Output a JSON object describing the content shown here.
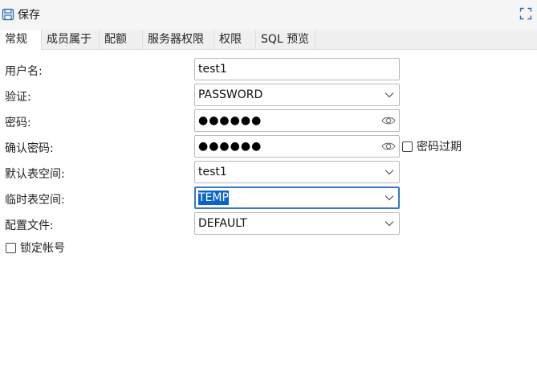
{
  "toolbar": {
    "save_label": "保存",
    "save_icon": "floppy-disk-icon",
    "expand_icon": "fullscreen-expand-icon"
  },
  "tabs": [
    {
      "label": "常规",
      "active": true
    },
    {
      "label": "成员属于",
      "active": false
    },
    {
      "label": "配额",
      "active": false
    },
    {
      "label": "服务器权限",
      "active": false
    },
    {
      "label": "权限",
      "active": false
    },
    {
      "label": "SQL 预览",
      "active": false
    }
  ],
  "form": {
    "username": {
      "label": "用户名:",
      "value": "test1"
    },
    "auth": {
      "label": "验证:",
      "value": "PASSWORD"
    },
    "password": {
      "label": "密码:",
      "masked": "●●●●●●"
    },
    "confirm_password": {
      "label": "确认密码:",
      "masked": "●●●●●●"
    },
    "password_expired": {
      "label": "密码过期",
      "checked": false
    },
    "default_tablespace": {
      "label": "默认表空间:",
      "value": "test1"
    },
    "temp_tablespace": {
      "label": "临时表空间:",
      "value": "TEMP"
    },
    "profile": {
      "label": "配置文件:",
      "value": "DEFAULT"
    },
    "lock_account": {
      "label": "锁定帐号",
      "checked": false
    }
  },
  "colors": {
    "accent": "#0a64c8",
    "focus_border": "#3478c6",
    "tab_bar": "#f0f0f0",
    "toolbar": "#f5f5f5"
  }
}
